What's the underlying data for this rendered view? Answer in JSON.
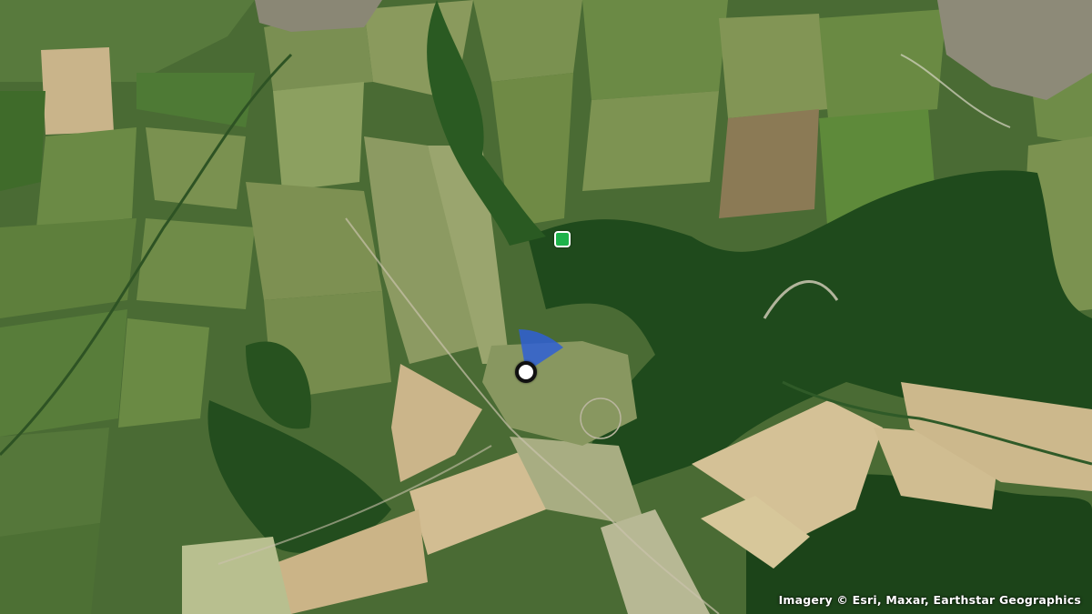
{
  "map": {
    "type": "satellite",
    "attribution": "Imagery © Esri, Maxar, Earthstar Geographics"
  },
  "markers": {
    "poi_color": "#1db24a",
    "heading_color": "#2f5fd6"
  }
}
